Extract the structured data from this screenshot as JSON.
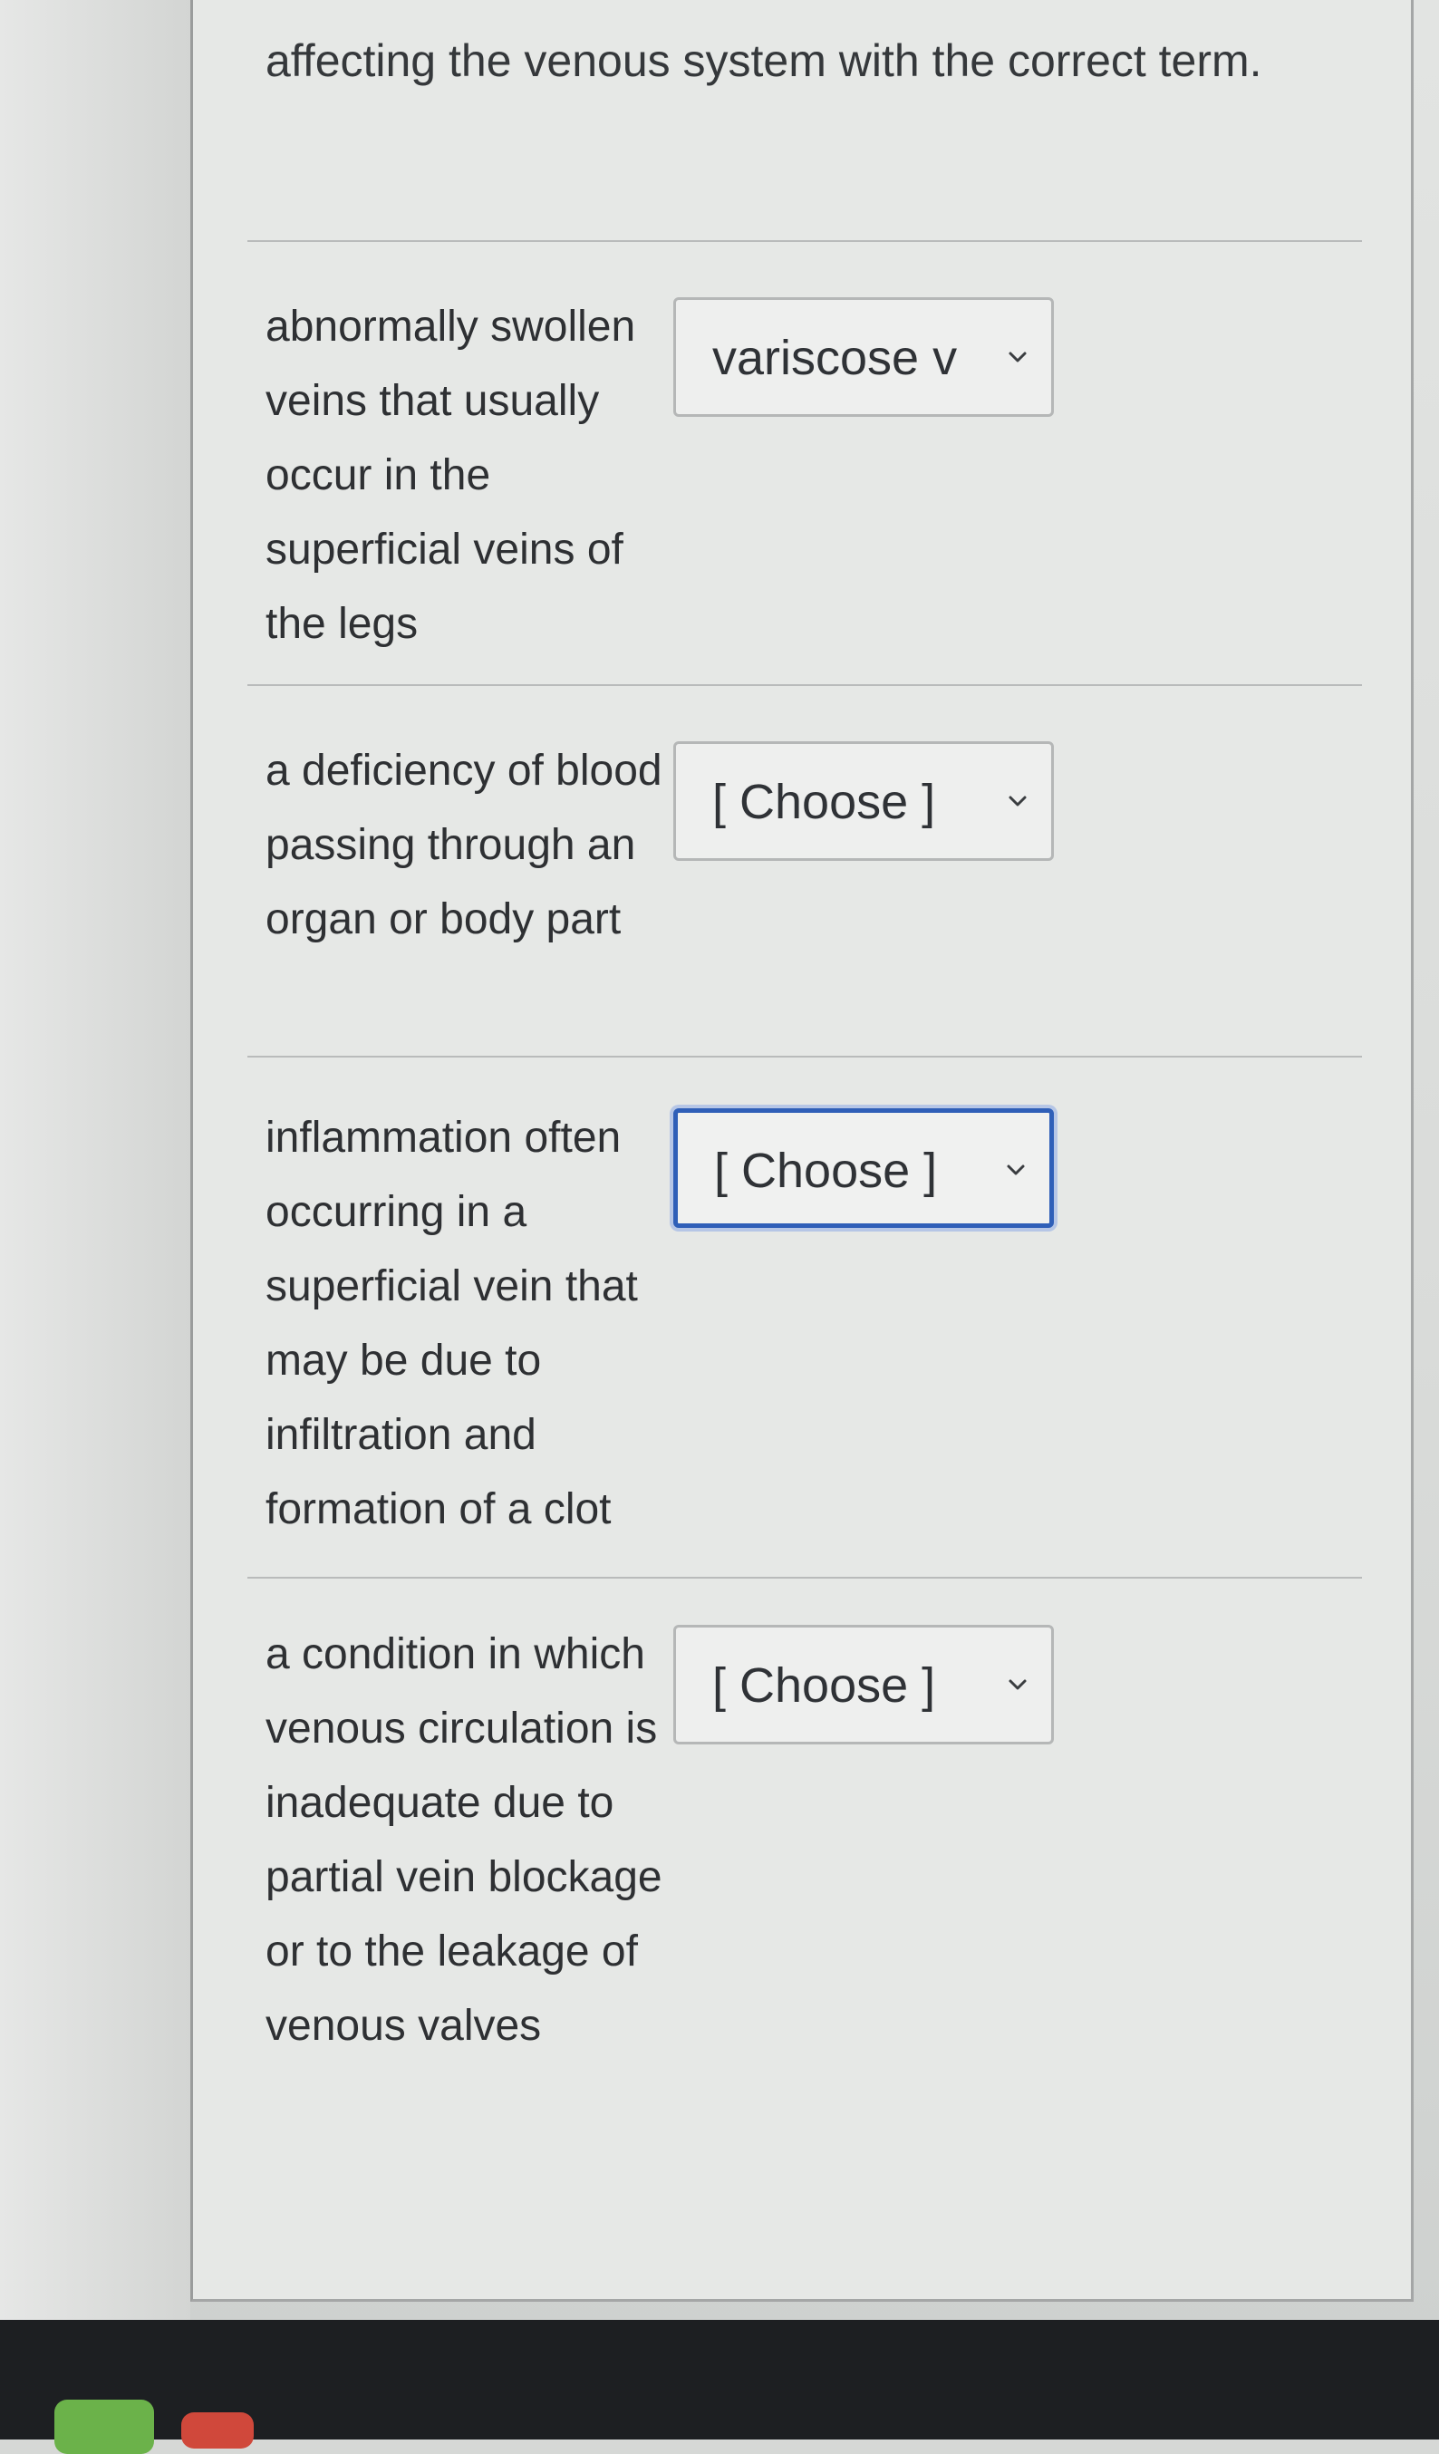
{
  "question": {
    "prompt": "affecting the venous system with the correct term."
  },
  "rows": [
    {
      "description": "abnormally swollen veins that usually occur in the superficial veins of the legs",
      "selected": "variscose v"
    },
    {
      "description": "a deficiency of blood passing through an organ or body part",
      "selected": "[ Choose ]"
    },
    {
      "description": "inflammation often occurring in a superficial vein that may be due to infiltration and formation of a clot",
      "selected": "[ Choose ]"
    },
    {
      "description": "a condition in which venous circulation is inadequate due to partial vein blockage or to the leakage of venous valves",
      "selected": "[ Choose ]"
    }
  ],
  "colors": {
    "focus_border": "#2f5fb8",
    "card_background": "#e6e8e6",
    "text": "#2e3033"
  },
  "icons": {
    "dropdown": "chevron-down-icon"
  }
}
